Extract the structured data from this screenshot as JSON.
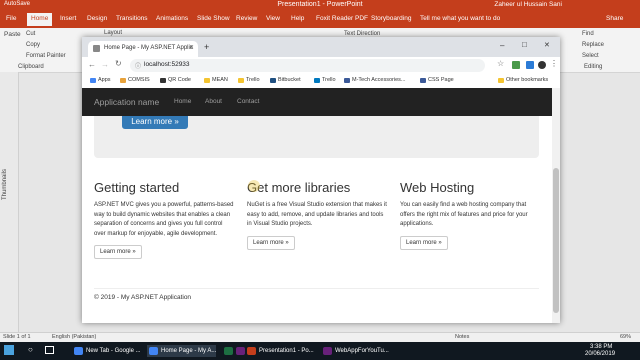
{
  "powerpoint": {
    "autosave": "AutoSave",
    "title": "Presentation1 - PowerPoint",
    "user": "Zaheer ul Hussain Sani",
    "tabs": [
      "File",
      "Home",
      "Insert",
      "Design",
      "Transitions",
      "Animations",
      "Slide Show",
      "Review",
      "View",
      "Help",
      "Foxit Reader PDF",
      "Storyboarding",
      "Tell me what you want to do"
    ],
    "share": "Share",
    "ribbon": {
      "paste": "Paste",
      "cut": "Cut",
      "copy": "Copy",
      "format_painter": "Format Painter",
      "clipboard": "Clipboard",
      "layout": "Layout",
      "text_direction": "Text Direction",
      "find": "Find",
      "replace": "Replace",
      "select": "Select",
      "editing": "Editing"
    },
    "thumbnails": "Thumbnails",
    "status": {
      "slide": "Slide 1 of 1",
      "language": "English (Pakistan)",
      "notes": "Notes",
      "zoom": "69%"
    }
  },
  "chrome": {
    "tab_title": "Home Page - My ASP.NET Applic",
    "new_tab": "+",
    "minimize": "–",
    "maximize": "□",
    "close": "✕",
    "url": "localhost:52933",
    "bookmarks": [
      {
        "label": "Apps",
        "color": "#4285f4"
      },
      {
        "label": "COMSIS",
        "color": "#e8a23a"
      },
      {
        "label": "QR Code",
        "color": "#333333"
      },
      {
        "label": "MEAN",
        "color": "#f4c430"
      },
      {
        "label": "Trello",
        "color": "#0079bf"
      },
      {
        "label": "Bitbucket",
        "color": "#205081"
      },
      {
        "label": "Trello",
        "color": "#0079bf"
      },
      {
        "label": "M-Tech Accessories...",
        "color": "#3b5998"
      },
      {
        "label": "CSS Page",
        "color": "#3b5998"
      }
    ],
    "other_bookmarks": "Other bookmarks"
  },
  "page": {
    "brand": "Application name",
    "nav": [
      "Home",
      "About",
      "Contact"
    ],
    "jumbo_button": "Learn more »",
    "columns": [
      {
        "title": "Getting started",
        "text": "ASP.NET MVC gives you a powerful, patterns-based way to build dynamic websites that enables a clean separation of concerns and gives you full control over markup for enjoyable, agile development.",
        "button": "Learn more »"
      },
      {
        "title": "Get more libraries",
        "text": "NuGet is a free Visual Studio extension that makes it easy to add, remove, and update libraries and tools in Visual Studio projects.",
        "button": "Learn more »"
      },
      {
        "title": "Web Hosting",
        "text": "You can easily find a web hosting company that offers the right mix of features and price for your applications.",
        "button": "Learn more »"
      }
    ],
    "footer": "© 2019 - My ASP.NET Application"
  },
  "taskbar": {
    "items": [
      {
        "label": "New Tab - Google ...",
        "color": "#4285f4"
      },
      {
        "label": "Home Page - My A...",
        "color": "#4285f4"
      },
      {
        "label": "",
        "color": "#1d6f42"
      },
      {
        "label": "",
        "color": "#68217a"
      },
      {
        "label": "Presentation1 - Po...",
        "color": "#c43e1c"
      },
      {
        "label": "WebAppForYouTu...",
        "color": "#68217a"
      }
    ],
    "time": "3:38 PM",
    "date": "20/06/2019"
  }
}
